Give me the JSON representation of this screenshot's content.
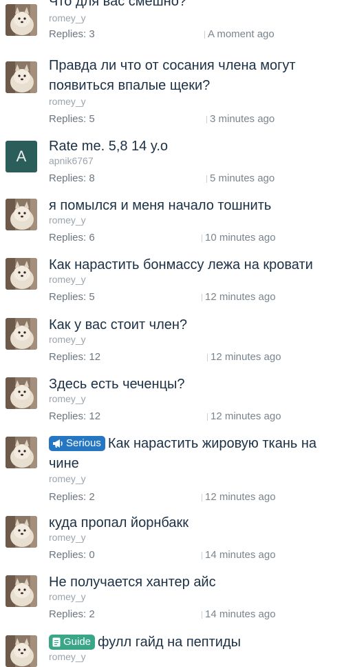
{
  "threads": [
    {
      "title": "Что для вас смешно?",
      "author": "romey_y",
      "replies": "Replies: 3",
      "time": "A moment ago",
      "avatar": "dog"
    },
    {
      "title": "Правда ли что от сосания члена могут появиться впалые щеки?",
      "author": "romey_y",
      "replies": "Replies: 5",
      "time": "3 minutes ago",
      "avatar": "dog"
    },
    {
      "title": "Rate me. 5,8 14 y.o",
      "author": "apnik6767",
      "replies": "Replies: 8",
      "time": "5 minutes ago",
      "avatar": "letter",
      "avatar_letter": "A",
      "avatar_color": "#2b5e5b"
    },
    {
      "title": "я помылся и меня начало тошнить",
      "author": "romey_y",
      "replies": "Replies: 6",
      "time": "10 minutes ago",
      "avatar": "dog"
    },
    {
      "title": "Как нарастить бонмассу лежа на кровати",
      "author": "romey_y",
      "replies": "Replies: 5",
      "time": "12 minutes ago",
      "avatar": "dog"
    },
    {
      "title": "Как у вас стоит член?",
      "author": "romey_y",
      "replies": "Replies: 12",
      "time": "12 minutes ago",
      "avatar": "dog"
    },
    {
      "title": "Здесь есть чеченцы?",
      "author": "romey_y",
      "replies": "Replies: 12",
      "time": "12 minutes ago",
      "avatar": "dog"
    },
    {
      "title": "Как нарастить жировую ткань на чине",
      "author": "romey_y",
      "replies": "Replies: 2",
      "time": "12 minutes ago",
      "avatar": "dog",
      "prefix": {
        "label": "Serious",
        "color": "#2577c4",
        "icon": "megaphone-icon"
      }
    },
    {
      "title": "куда пропал йорнбакк",
      "author": "romey_y",
      "replies": "Replies: 0",
      "time": "14 minutes ago",
      "avatar": "dog"
    },
    {
      "title": "Не получается хантер айс",
      "author": "romey_y",
      "replies": "Replies: 2",
      "time": "14 minutes ago",
      "avatar": "dog"
    },
    {
      "title": "фулл гайд на пептиды",
      "author": "romey_y",
      "replies": "",
      "time": "",
      "avatar": "dog",
      "prefix": {
        "label": "Guide",
        "color": "#3aa688",
        "icon": "document-icon"
      }
    }
  ]
}
